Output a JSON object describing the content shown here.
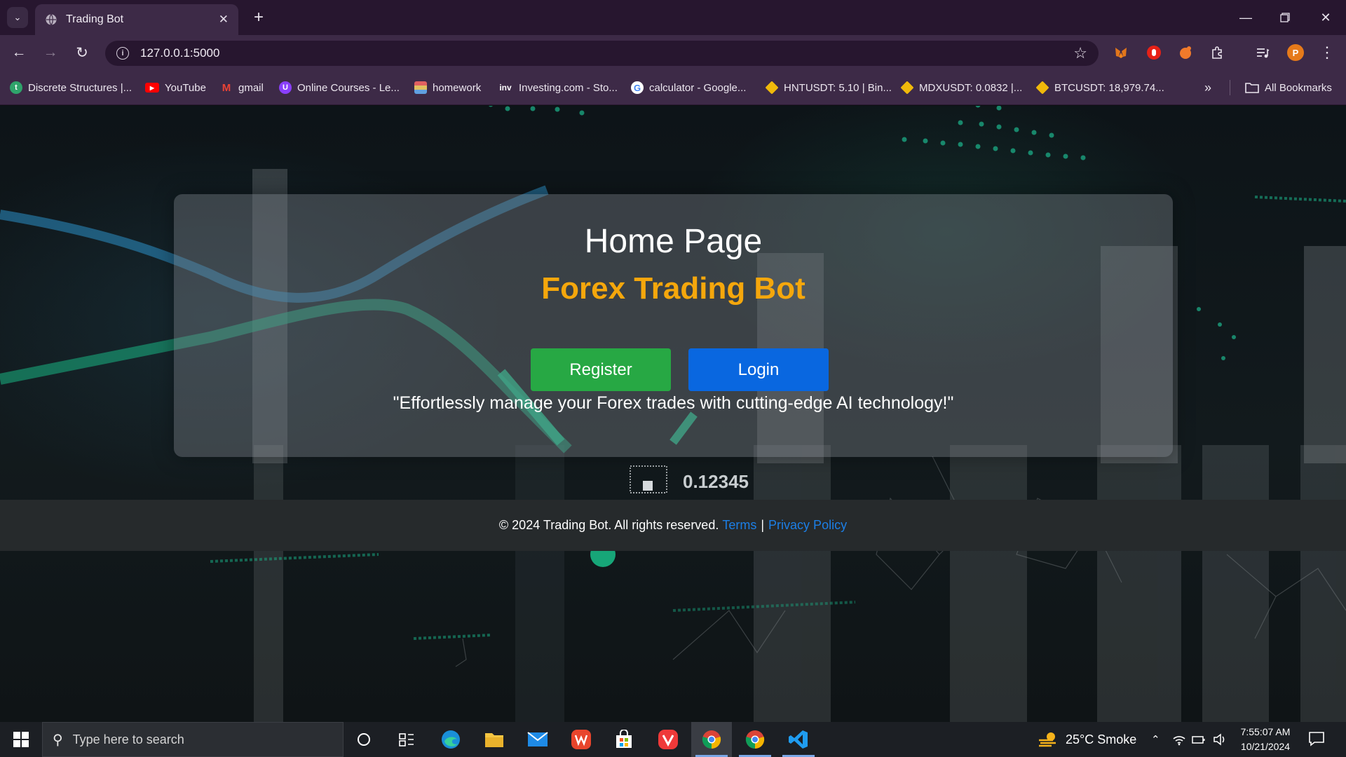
{
  "browser": {
    "tab_title": "Trading Bot",
    "url": "127.0.0.1:5000",
    "profile_initial": "P",
    "all_bookmarks": "All Bookmarks",
    "bookmarks": [
      {
        "label": "Discrete Structures |...",
        "icon": "discrete-structures-favicon",
        "color": "#2fa36b"
      },
      {
        "label": "YouTube",
        "icon": "youtube-icon",
        "color": "#ff0000"
      },
      {
        "label": "gmail",
        "icon": "gmail-icon",
        "color": "#ea4335"
      },
      {
        "label": "Online Courses - Le...",
        "icon": "udemy-icon",
        "color": "#8a3ffc"
      },
      {
        "label": "homework",
        "icon": "books-icon",
        "color": "#d9534f"
      },
      {
        "label": "Investing.com - Sto...",
        "icon": "investing-icon",
        "color": "#ffffff"
      },
      {
        "label": "calculator - Google...",
        "icon": "google-icon",
        "color": "#ffffff"
      },
      {
        "label": "HNTUSDT: 5.10 | Bin...",
        "icon": "binance-icon",
        "color": "#f0b90b"
      },
      {
        "label": "MDXUSDT: 0.0832 |...",
        "icon": "binance-icon",
        "color": "#f0b90b"
      },
      {
        "label": "BTCUSDT: 18,979.74...",
        "icon": "binance-icon",
        "color": "#f0b90b"
      }
    ]
  },
  "page": {
    "title": "Home Page",
    "subtitle": "Forex Trading Bot",
    "register_label": "Register",
    "login_label": "Login",
    "tagline": "\"Effortlessly manage your Forex trades with cutting-edge AI technology!\"",
    "footer": {
      "copyright": "© 2024 Trading Bot. All rights reserved.",
      "terms": "Terms",
      "separator": "|",
      "privacy": "Privacy Policy"
    },
    "background_readout": "0.12345",
    "colors": {
      "subtitle": "#f5a70c",
      "register": "#27a844",
      "login": "#0967e0",
      "footer_link": "#1c7fe6"
    }
  },
  "taskbar": {
    "search_placeholder": "Type here to search",
    "weather": "25°C  Smoke",
    "time": "7:55:07 AM",
    "date": "10/21/2024"
  }
}
